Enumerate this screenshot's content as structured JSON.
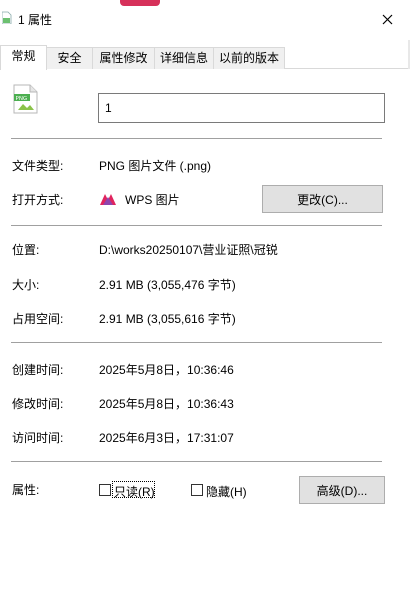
{
  "window": {
    "title": "1 属性",
    "close_glyph": "✕"
  },
  "tabs": [
    {
      "label": "常规",
      "active": true
    },
    {
      "label": "安全",
      "active": false
    },
    {
      "label": "属性修改",
      "active": false
    },
    {
      "label": "详细信息",
      "active": false
    },
    {
      "label": "以前的版本",
      "active": false
    }
  ],
  "general": {
    "file_icon_text": "PNG",
    "filename": "1",
    "type_label": "文件类型:",
    "type_value": "PNG 图片文件 (.png)",
    "open_with_label": "打开方式:",
    "open_with_value": "WPS 图片",
    "change_button": "更改(C)...",
    "location_label": "位置:",
    "location_value": "D:\\works20250107\\营业证照\\冠锐",
    "size_label": "大小:",
    "size_value": "2.91 MB (3,055,476 字节)",
    "disk_size_label": "占用空间:",
    "disk_size_value": "2.91 MB (3,055,616 字节)",
    "created_label": "创建时间:",
    "created_value": "2025年5月8日，10:36:46",
    "modified_label": "修改时间:",
    "modified_value": "2025年5月8日，10:36:43",
    "accessed_label": "访问时间:",
    "accessed_value": "2025年6月3日，17:31:07",
    "attributes_label": "属性:",
    "readonly_label": "只读(R)",
    "readonly_checked": false,
    "hidden_label": "隐藏(H)",
    "hidden_checked": false,
    "advanced_button": "高级(D)..."
  },
  "colors": {
    "accent_pink": "#d6315a",
    "button_bg": "#e1e1e1",
    "separator": "#a0a0a0",
    "wps_brand": "#e0245e"
  }
}
